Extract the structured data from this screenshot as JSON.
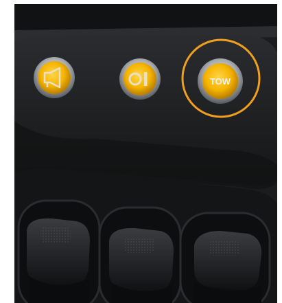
{
  "image": {
    "background_color": "#ffffff",
    "panel_color": "#1d1e20"
  },
  "buttons": [
    {
      "name": "horn",
      "icon": "horn-icon",
      "color": "#f5b400"
    },
    {
      "name": "work-light",
      "icon": "light-toggle-icon",
      "color": "#f5b400"
    },
    {
      "name": "tow",
      "icon": "tow-icon",
      "label": "TOW",
      "color": "#f5b400"
    }
  ],
  "highlight": {
    "target": "tow",
    "shape": "circle",
    "color": "#f0a020"
  },
  "joysticks": [
    {
      "name": "joystick-left"
    },
    {
      "name": "joystick-middle"
    },
    {
      "name": "joystick-right"
    }
  ]
}
